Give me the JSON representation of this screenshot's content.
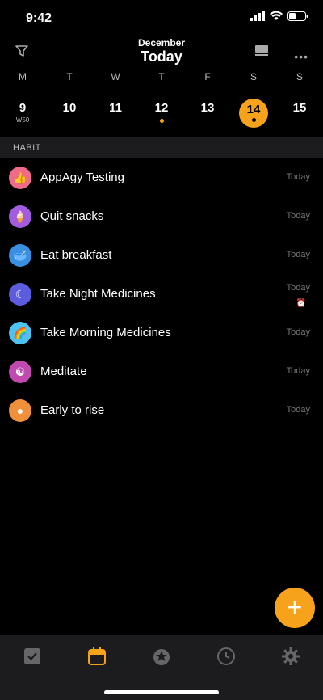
{
  "status": {
    "time": "9:42"
  },
  "header": {
    "month": "December",
    "title": "Today"
  },
  "week": {
    "days": [
      "M",
      "T",
      "W",
      "T",
      "F",
      "S",
      "S"
    ],
    "dates": [
      {
        "num": "9",
        "sub": "W50",
        "dot": false,
        "selected": false
      },
      {
        "num": "10",
        "sub": "",
        "dot": false,
        "selected": false
      },
      {
        "num": "11",
        "sub": "",
        "dot": false,
        "selected": false
      },
      {
        "num": "12",
        "sub": "",
        "dot": true,
        "selected": false
      },
      {
        "num": "13",
        "sub": "",
        "dot": false,
        "selected": false
      },
      {
        "num": "14",
        "sub": "",
        "dot": true,
        "selected": true
      },
      {
        "num": "15",
        "sub": "",
        "dot": false,
        "selected": false
      }
    ]
  },
  "section": {
    "label": "HABIT"
  },
  "habits": [
    {
      "name": "AppAgy Testing",
      "when": "Today",
      "icon": "thumbs-up-icon",
      "color": "#f06a8a",
      "glyph": "👍"
    },
    {
      "name": "Quit snacks",
      "when": "Today",
      "icon": "snack-icon",
      "color": "#a35ce0",
      "glyph": "🍦"
    },
    {
      "name": "Eat breakfast",
      "when": "Today",
      "icon": "breakfast-icon",
      "color": "#3a8fe0",
      "glyph": "🥣"
    },
    {
      "name": "Take Night Medicines",
      "when": "Today",
      "icon": "moon-sleep-icon",
      "color": "#5c5ce0",
      "glyph": "☾",
      "alarm": "⏰"
    },
    {
      "name": "Take Morning Medicines",
      "when": "Today",
      "icon": "rainbow-icon",
      "color": "#4cc3f0",
      "glyph": "🌈"
    },
    {
      "name": "Meditate",
      "when": "Today",
      "icon": "meditate-icon",
      "color": "#c04ab0",
      "glyph": "☯"
    },
    {
      "name": "Early to rise",
      "when": "Today",
      "icon": "balloon-icon",
      "color": "#f0903a",
      "glyph": "●"
    }
  ],
  "fab": {
    "label": "+"
  },
  "tabs": [
    {
      "name": "tab-tasks",
      "icon": "checkbox-icon"
    },
    {
      "name": "tab-calendar",
      "icon": "calendar-icon"
    },
    {
      "name": "tab-habit",
      "icon": "habit-icon"
    },
    {
      "name": "tab-timer",
      "icon": "clock-icon"
    },
    {
      "name": "tab-settings",
      "icon": "gear-icon"
    }
  ],
  "colors": {
    "accent": "#f7a21b",
    "background": "#000000",
    "tabbar": "#1c1c1e"
  }
}
